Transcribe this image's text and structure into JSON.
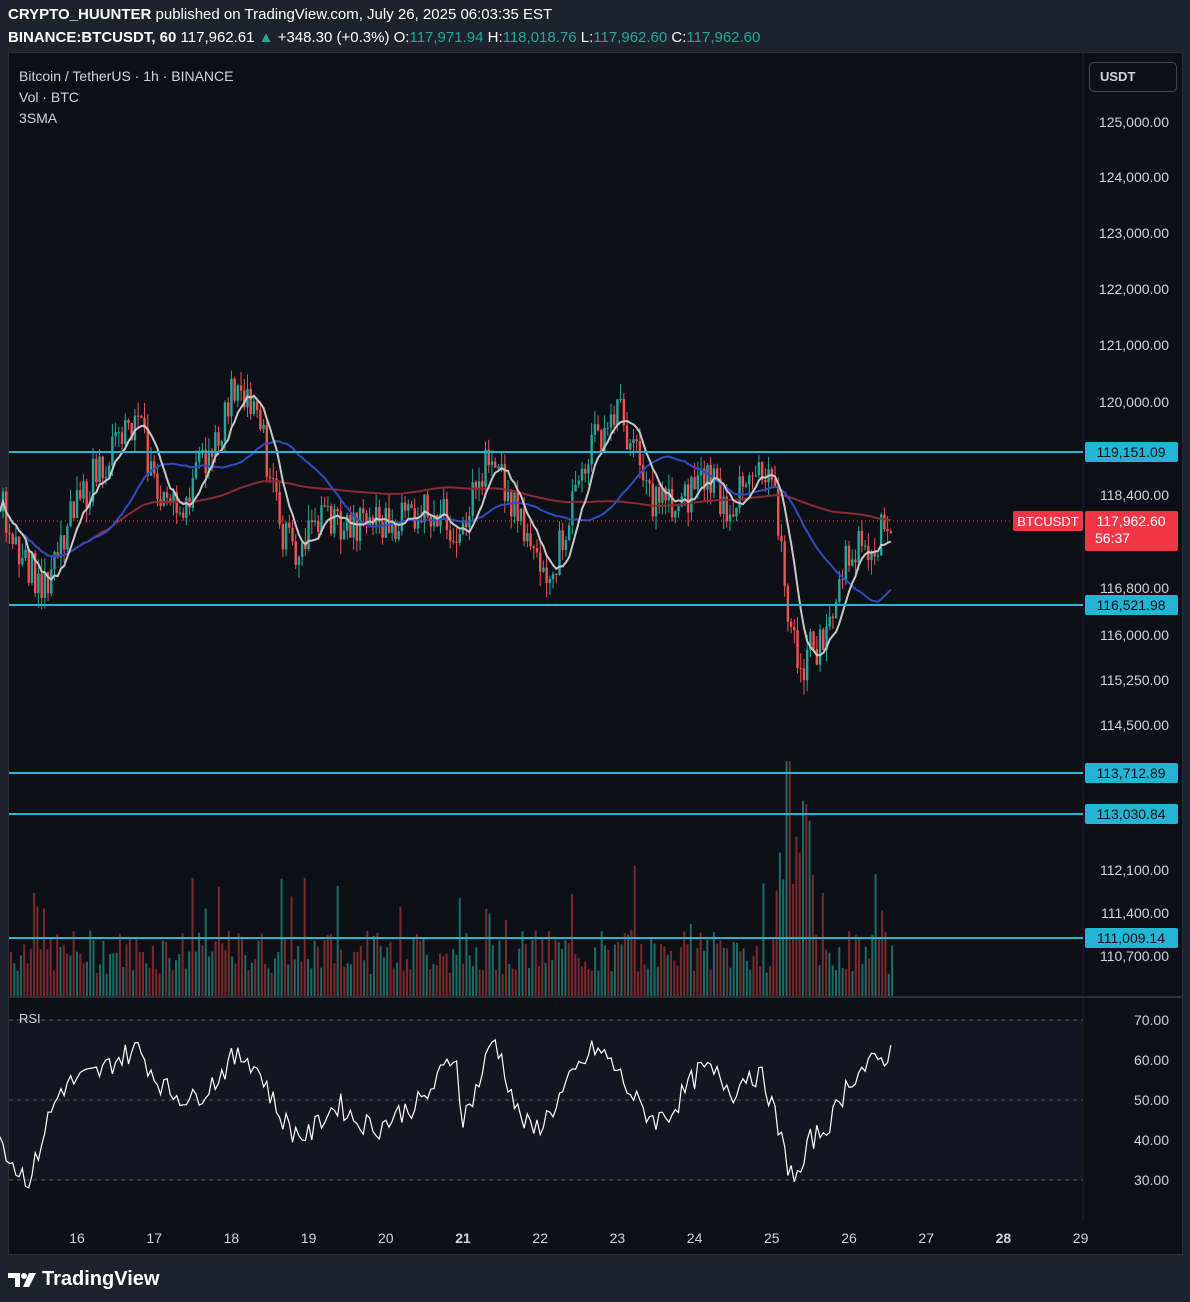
{
  "header": {
    "author": "CRYPTO_HUUNTER",
    "published_text": " published on TradingView.com, July 26, 2025 06:03:35 EST",
    "symbol_tf": "BINANCE:BTCUSDT, 60",
    "price": "117,962.61",
    "change_arrow": "▲",
    "change": "+348.30 (+0.3%)",
    "o_label": "O:",
    "o": "117,971.94",
    "h_label": "H:",
    "h": "118,018.76",
    "l_label": "L:",
    "l": "117,962.60",
    "c_label": "C:",
    "c": "117,962.60"
  },
  "legend": {
    "title": "Bitcoin / TetherUS · 1h · BINANCE",
    "vol": "Vol · BTC",
    "sma": "3SMA"
  },
  "currency_button": "USDT",
  "rsi_label": "RSI",
  "last_price": {
    "symbol": "BTCUSDT",
    "value": "117,962.60",
    "countdown": "56:37"
  },
  "brand": "TradingView",
  "colors": {
    "up": "#26a69a",
    "down": "#ef5350",
    "level": "#22b5d4",
    "price_tag": "#f23645",
    "sma_fast": "#c8c8c8",
    "sma_mid": "#2f4dbf",
    "sma_slow": "#8b2a32",
    "rsi_line": "#ffffff"
  },
  "chart_data": {
    "type": "candlestick",
    "timeframe": "1h",
    "y_axis_ticks": [
      "125,000.00",
      "124,000.00",
      "123,000.00",
      "122,000.00",
      "121,000.00",
      "120,000.00",
      "118,400.00",
      "116,800.00",
      "116,000.00",
      "115,250.00",
      "114,500.00",
      "112,100.00",
      "111,400.00",
      "110,700.00"
    ],
    "x_axis_ticks": [
      "16",
      "17",
      "18",
      "19",
      "20",
      "21",
      "22",
      "23",
      "24",
      "25",
      "26",
      "27",
      "28",
      "29"
    ],
    "horizontal_levels": [
      "119,151.09",
      "116,521.98",
      "113,712.89",
      "113,030.84",
      "111,009.14"
    ],
    "close_path": [
      [
        15.0,
        118300
      ],
      [
        15.3,
        117400
      ],
      [
        15.6,
        116700
      ],
      [
        15.9,
        117900
      ],
      [
        16.2,
        118700
      ],
      [
        16.5,
        119300
      ],
      [
        16.8,
        119600
      ],
      [
        17.0,
        118600
      ],
      [
        17.3,
        118100
      ],
      [
        17.6,
        118900
      ],
      [
        17.9,
        119700
      ],
      [
        18.1,
        120500
      ],
      [
        18.4,
        119400
      ],
      [
        18.6,
        118000
      ],
      [
        18.8,
        117400
      ],
      [
        19.0,
        117700
      ],
      [
        19.2,
        118100
      ],
      [
        19.4,
        117900
      ],
      [
        19.6,
        117800
      ],
      [
        19.8,
        118000
      ],
      [
        20.0,
        117900
      ],
      [
        20.3,
        118100
      ],
      [
        20.6,
        118200
      ],
      [
        20.9,
        117800
      ],
      [
        21.1,
        118300
      ],
      [
        21.3,
        118900
      ],
      [
        21.5,
        118600
      ],
      [
        21.8,
        117700
      ],
      [
        22.0,
        117100
      ],
      [
        22.2,
        117300
      ],
      [
        22.4,
        118200
      ],
      [
        22.6,
        119100
      ],
      [
        22.8,
        119500
      ],
      [
        23.0,
        119900
      ],
      [
        23.2,
        119200
      ],
      [
        23.4,
        118400
      ],
      [
        23.6,
        118300
      ],
      [
        23.8,
        118100
      ],
      [
        24.0,
        118600
      ],
      [
        24.2,
        118800
      ],
      [
        24.4,
        118200
      ],
      [
        24.6,
        118400
      ],
      [
        24.8,
        118700
      ],
      [
        25.0,
        118500
      ],
      [
        25.1,
        117800
      ],
      [
        25.25,
        116000
      ],
      [
        25.4,
        115500
      ],
      [
        25.5,
        115800
      ],
      [
        25.7,
        115900
      ],
      [
        25.8,
        116600
      ],
      [
        26.0,
        117400
      ],
      [
        26.2,
        117600
      ],
      [
        26.4,
        117700
      ],
      [
        26.55,
        117960
      ]
    ],
    "indicators": [
      "SMA fast (white)",
      "SMA mid (blue)",
      "SMA slow (dark red)"
    ],
    "rsi": {
      "levels": [
        70,
        50,
        30
      ],
      "ticks": [
        "70.00",
        "60.00",
        "50.00",
        "40.00",
        "30.00"
      ],
      "path": [
        [
          15.0,
          41
        ],
        [
          15.2,
          33
        ],
        [
          15.4,
          30
        ],
        [
          15.6,
          44
        ],
        [
          15.8,
          53
        ],
        [
          16.0,
          55
        ],
        [
          16.3,
          57
        ],
        [
          16.5,
          60
        ],
        [
          16.8,
          63
        ],
        [
          17.0,
          56
        ],
        [
          17.2,
          52
        ],
        [
          17.5,
          50
        ],
        [
          17.8,
          55
        ],
        [
          18.0,
          60
        ],
        [
          18.2,
          61
        ],
        [
          18.4,
          56
        ],
        [
          18.6,
          47
        ],
        [
          18.8,
          42
        ],
        [
          19.0,
          41
        ],
        [
          19.2,
          46
        ],
        [
          19.4,
          49
        ],
        [
          19.6,
          45
        ],
        [
          19.9,
          43
        ],
        [
          20.2,
          47
        ],
        [
          20.5,
          50
        ],
        [
          20.7,
          56
        ],
        [
          20.9,
          62
        ],
        [
          21.0,
          45
        ],
        [
          21.2,
          54
        ],
        [
          21.4,
          66
        ],
        [
          21.5,
          60
        ],
        [
          21.7,
          47
        ],
        [
          21.9,
          42
        ],
        [
          22.1,
          46
        ],
        [
          22.3,
          52
        ],
        [
          22.5,
          58
        ],
        [
          22.7,
          63
        ],
        [
          22.9,
          60
        ],
        [
          23.1,
          54
        ],
        [
          23.3,
          48
        ],
        [
          23.5,
          45
        ],
        [
          23.7,
          47
        ],
        [
          23.9,
          53
        ],
        [
          24.1,
          58
        ],
        [
          24.3,
          56
        ],
        [
          24.5,
          52
        ],
        [
          24.7,
          57
        ],
        [
          24.9,
          55
        ],
        [
          25.0,
          49
        ],
        [
          25.2,
          34
        ],
        [
          25.35,
          30
        ],
        [
          25.5,
          40
        ],
        [
          25.65,
          42
        ],
        [
          25.8,
          46
        ],
        [
          26.0,
          55
        ],
        [
          26.2,
          58
        ],
        [
          26.4,
          60
        ],
        [
          26.55,
          62
        ]
      ]
    }
  }
}
